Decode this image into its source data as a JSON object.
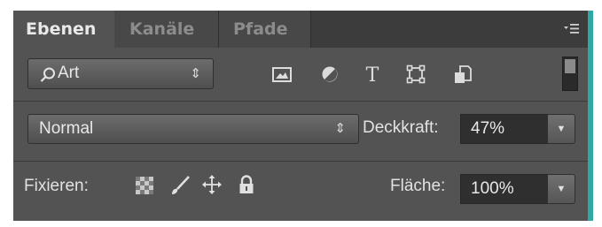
{
  "tabs": [
    {
      "label": "Ebenen",
      "active": true
    },
    {
      "label": "Kanäle",
      "active": false
    },
    {
      "label": "Pfade",
      "active": false
    }
  ],
  "panel_menu_icon": "panel-menu-icon",
  "filter": {
    "selected": "Art",
    "icons": [
      "image-filter-icon",
      "adjustment-filter-icon",
      "text-filter-icon",
      "shape-filter-icon",
      "smart-object-filter-icon"
    ],
    "toggle_icon": "filter-toggle-icon"
  },
  "blend": {
    "mode": "Normal",
    "opacity_label": "Deckkraft:",
    "opacity_value": "47%"
  },
  "lock": {
    "label": "Fixieren:",
    "icons": [
      "lock-transparent-pixels-icon",
      "lock-image-pixels-icon",
      "lock-position-icon",
      "lock-all-icon"
    ],
    "fill_label": "Fläche:",
    "fill_value": "100%"
  },
  "colors": {
    "panel_bg": "#535353",
    "tabbar_bg": "#3c3c3c",
    "field_bg": "#2f2f2f",
    "accent_edge": "#2fa7a5"
  }
}
